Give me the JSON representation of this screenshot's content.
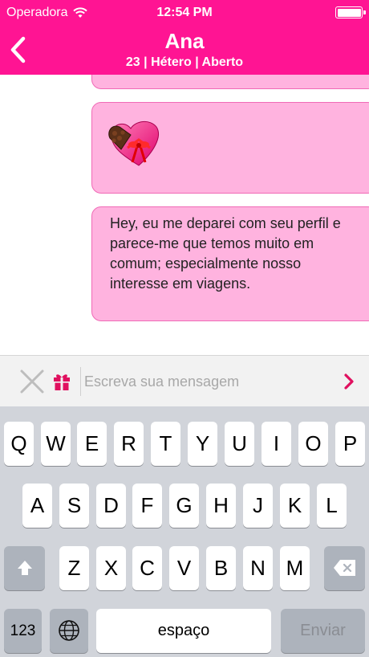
{
  "status_bar": {
    "carrier": "Operadora",
    "time": "12:54 PM"
  },
  "header": {
    "title": "Ana",
    "subtitle": "23 | Hétero | Aberto",
    "color": "#ff1493"
  },
  "chat": {
    "messages": [
      {
        "type": "text",
        "text": ""
      },
      {
        "type": "gift",
        "icon": "heart-chocolate-box"
      },
      {
        "type": "text",
        "text": "Hey, eu me deparei com seu perfil e parece-me que temos muito em comum; especialmente nosso interesse em viagens."
      }
    ],
    "bubble_color": "#ffb3df"
  },
  "input": {
    "placeholder": "Escreva sua mensagem",
    "value": ""
  },
  "keyboard": {
    "row1": [
      "Q",
      "W",
      "E",
      "R",
      "T",
      "Y",
      "U",
      "I",
      "O",
      "P"
    ],
    "row2": [
      "A",
      "S",
      "D",
      "F",
      "G",
      "H",
      "J",
      "K",
      "L"
    ],
    "row3": [
      "Z",
      "X",
      "C",
      "V",
      "B",
      "N",
      "M"
    ],
    "numbers_label": "123",
    "space_label": "espaço",
    "send_label": "Enviar"
  }
}
